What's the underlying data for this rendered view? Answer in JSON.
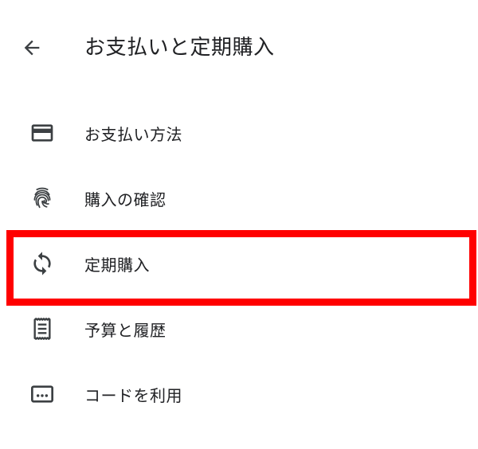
{
  "header": {
    "title": "お支払いと定期購入",
    "back_icon": "arrow-back-icon"
  },
  "menu": {
    "items": [
      {
        "label": "お支払い方法",
        "icon": "credit-card-icon"
      },
      {
        "label": "購入の確認",
        "icon": "fingerprint-icon"
      },
      {
        "label": "定期購入",
        "icon": "sync-icon"
      },
      {
        "label": "予算と履歴",
        "icon": "receipt-icon"
      },
      {
        "label": "コードを利用",
        "icon": "redeem-code-icon"
      }
    ]
  },
  "highlight": {
    "target": "定期購入",
    "color": "#ff0000"
  },
  "colors": {
    "text": "#202124",
    "icon": "#3c4043",
    "background": "#ffffff"
  }
}
